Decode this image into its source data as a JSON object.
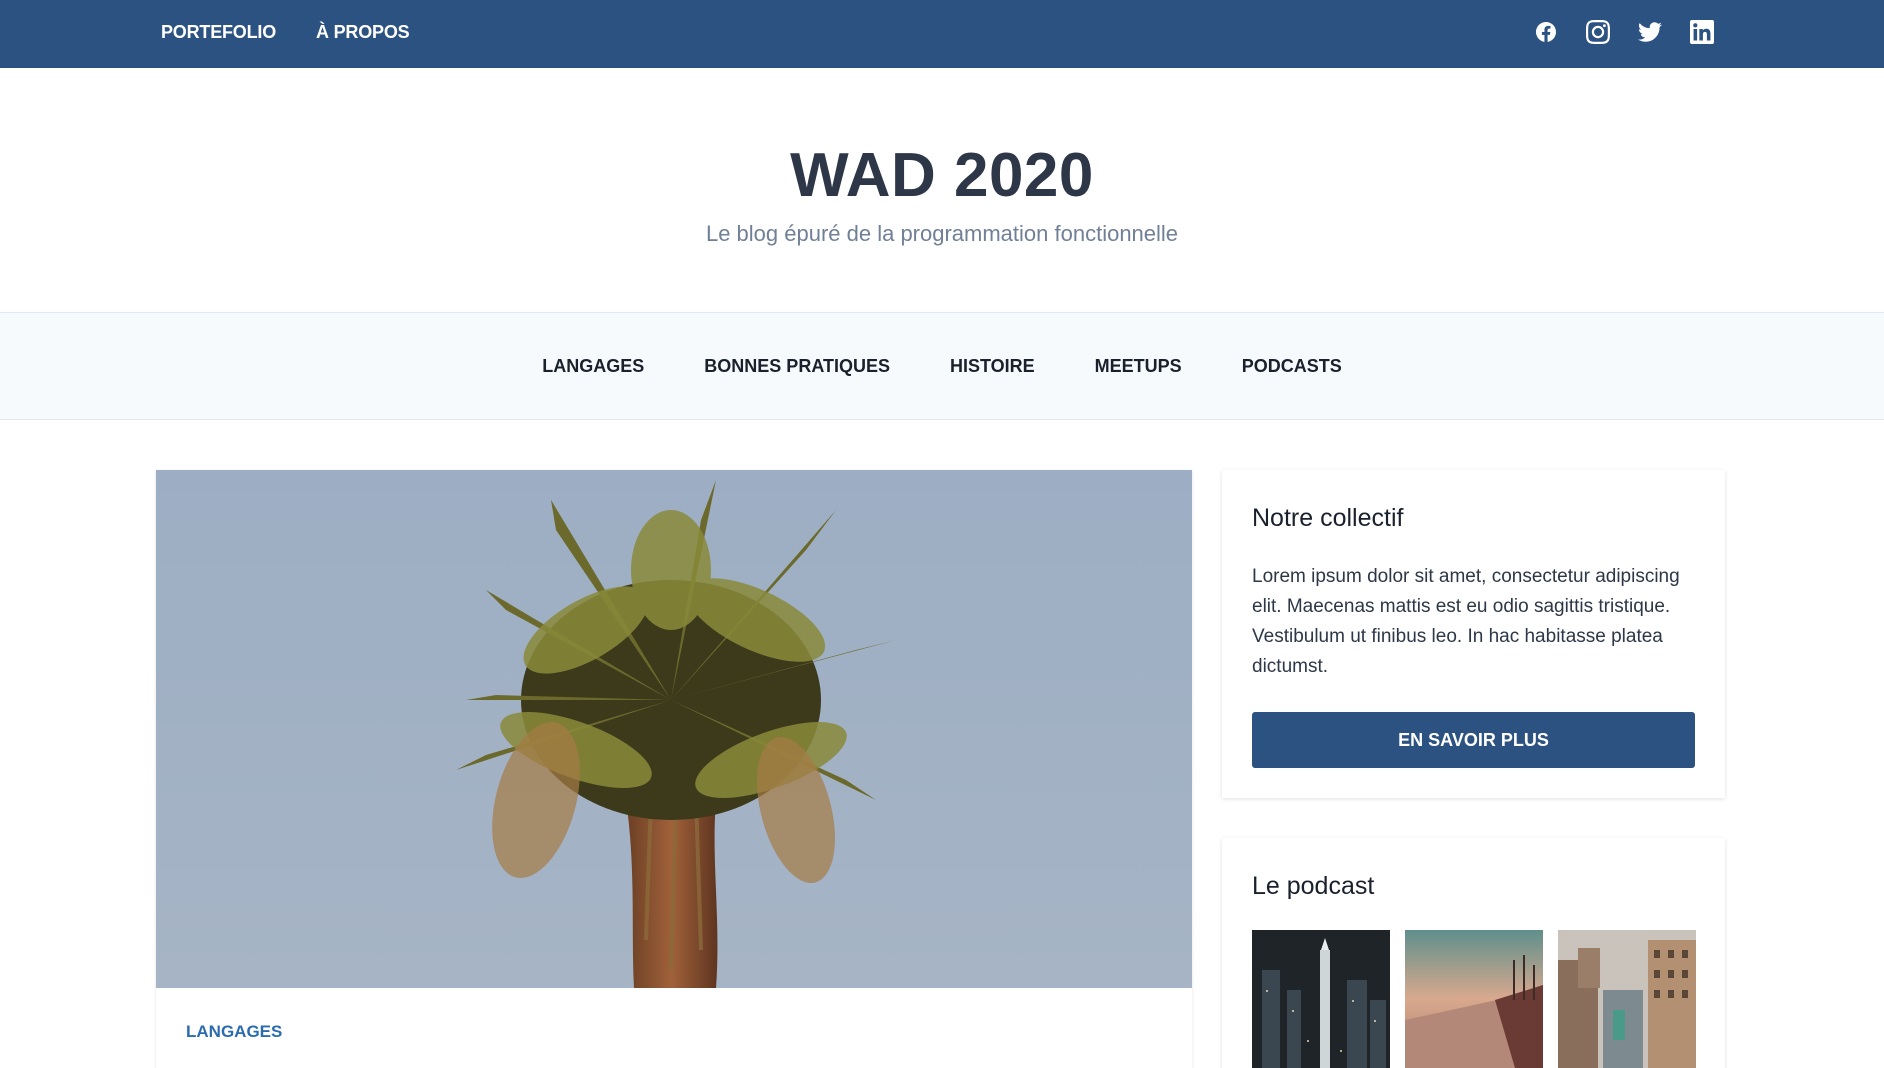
{
  "topbar": {
    "nav": [
      {
        "label": "PORTEFOLIO"
      },
      {
        "label": "À PROPOS"
      }
    ],
    "socials": [
      "facebook-icon",
      "instagram-icon",
      "twitter-icon",
      "linkedin-icon"
    ]
  },
  "header": {
    "title": "WAD 2020",
    "subtitle": "Le blog épuré de la programmation fonctionnelle"
  },
  "categories": [
    {
      "label": "LANGAGES"
    },
    {
      "label": "BONNES PRATIQUES"
    },
    {
      "label": "HISTOIRE"
    },
    {
      "label": "MEETUPS"
    },
    {
      "label": "PODCASTS"
    }
  ],
  "article": {
    "tag": "LANGAGES"
  },
  "sidebar": {
    "about": {
      "title": "Notre collectif",
      "text": "Lorem ipsum dolor sit amet, consectetur adipiscing elit. Maecenas mattis est eu odio sagittis tristique. Vestibulum ut finibus leo. In hac habitasse platea dictumst.",
      "button": "EN SAVOIR PLUS"
    },
    "podcast": {
      "title": "Le podcast"
    }
  },
  "colors": {
    "primary": "#2c5282",
    "link": "#2b6cb0",
    "title": "#2d3748",
    "subtitle": "#718096",
    "nav_bg": "#f7fafc"
  }
}
